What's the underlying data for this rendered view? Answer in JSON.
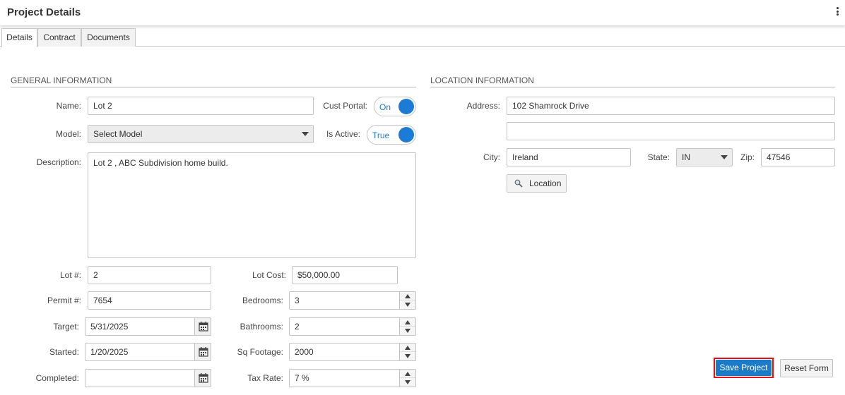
{
  "header": {
    "title": "Project Details"
  },
  "tabs": [
    {
      "label": "Details"
    },
    {
      "label": "Contract"
    },
    {
      "label": "Documents"
    }
  ],
  "general": {
    "section_title": "GENERAL INFORMATION",
    "name_label": "Name:",
    "name_value": "Lot 2",
    "cust_portal_label": "Cust Portal:",
    "cust_portal_value": "On",
    "model_label": "Model:",
    "model_value": "Select Model",
    "is_active_label": "Is Active:",
    "is_active_value": "True",
    "description_label": "Description:",
    "description_value": "Lot 2 , ABC Subdivision home build.",
    "lot_label": "Lot #:",
    "lot_value": "2",
    "lot_cost_label": "Lot Cost:",
    "lot_cost_value": "$50,000.00",
    "permit_label": "Permit #:",
    "permit_value": "7654",
    "bedrooms_label": "Bedrooms:",
    "bedrooms_value": "3",
    "target_label": "Target:",
    "target_value": "5/31/2025",
    "bathrooms_label": "Bathrooms:",
    "bathrooms_value": "2",
    "started_label": "Started:",
    "started_value": "1/20/2025",
    "sq_footage_label": "Sq Footage:",
    "sq_footage_value": "2000",
    "completed_label": "Completed:",
    "completed_value": "",
    "tax_rate_label": "Tax Rate:",
    "tax_rate_value": "7 %"
  },
  "location": {
    "section_title": "LOCATION INFORMATION",
    "address_label": "Address:",
    "address1_value": "102 Shamrock Drive",
    "address2_value": "",
    "city_label": "City:",
    "city_value": "Ireland",
    "state_label": "State:",
    "state_value": "IN",
    "zip_label": "Zip:",
    "zip_value": "47546",
    "location_button": "Location"
  },
  "actions": {
    "save_label": "Save Project",
    "reset_label": "Reset Form"
  },
  "colors": {
    "accent": "#1a7cc9",
    "highlight": "#e0131b"
  },
  "icons": {
    "kebab": "more-vertical-icon",
    "calendar": "calendar-icon",
    "search": "magnifier-icon"
  }
}
